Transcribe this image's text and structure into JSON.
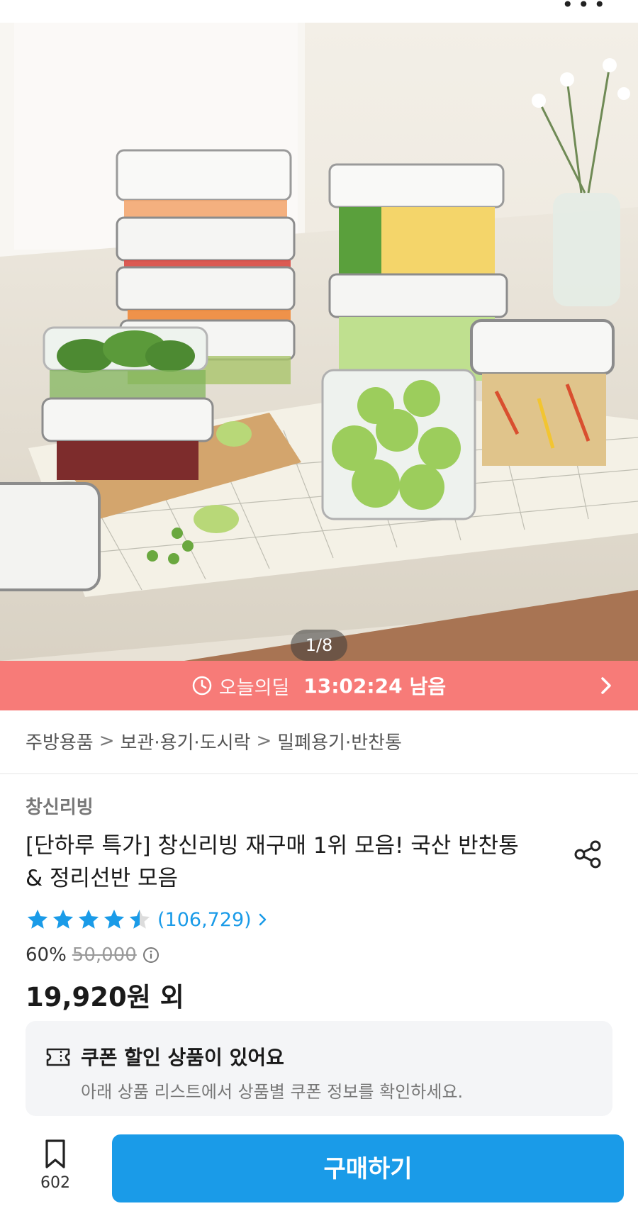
{
  "gallery": {
    "counter": "1/8"
  },
  "deal": {
    "label": "오늘의딜",
    "time_left": "13:02:24",
    "suffix": "남음",
    "icons": {
      "clock": "clock-icon",
      "chevron": "chevron-right-icon"
    }
  },
  "breadcrumb": {
    "items": [
      "주방용품",
      "보관·용기·도시락",
      "밀폐용기·반찬통"
    ],
    "separator": ">"
  },
  "product": {
    "brand": "창신리빙",
    "title": "[단하루 특가] 창신리빙 재구매 1위 모음! 국산 반찬통 & 정리선반 모음",
    "rating": 4.5,
    "review_count": "(106,729)",
    "discount_percent": "60%",
    "original_price": "50,000",
    "price": "19,920원 외"
  },
  "coupon": {
    "title": "쿠폰 할인 상품이 있어요",
    "description": "아래 상품 리스트에서 상품별 쿠폰 정보를 확인하세요."
  },
  "bottom_bar": {
    "bookmark_count": "602",
    "buy_label": "구매하기"
  },
  "colors": {
    "deal_bar": "#f77b78",
    "accent_blue": "#1a9be8",
    "coupon_bg": "#f4f5f7"
  }
}
